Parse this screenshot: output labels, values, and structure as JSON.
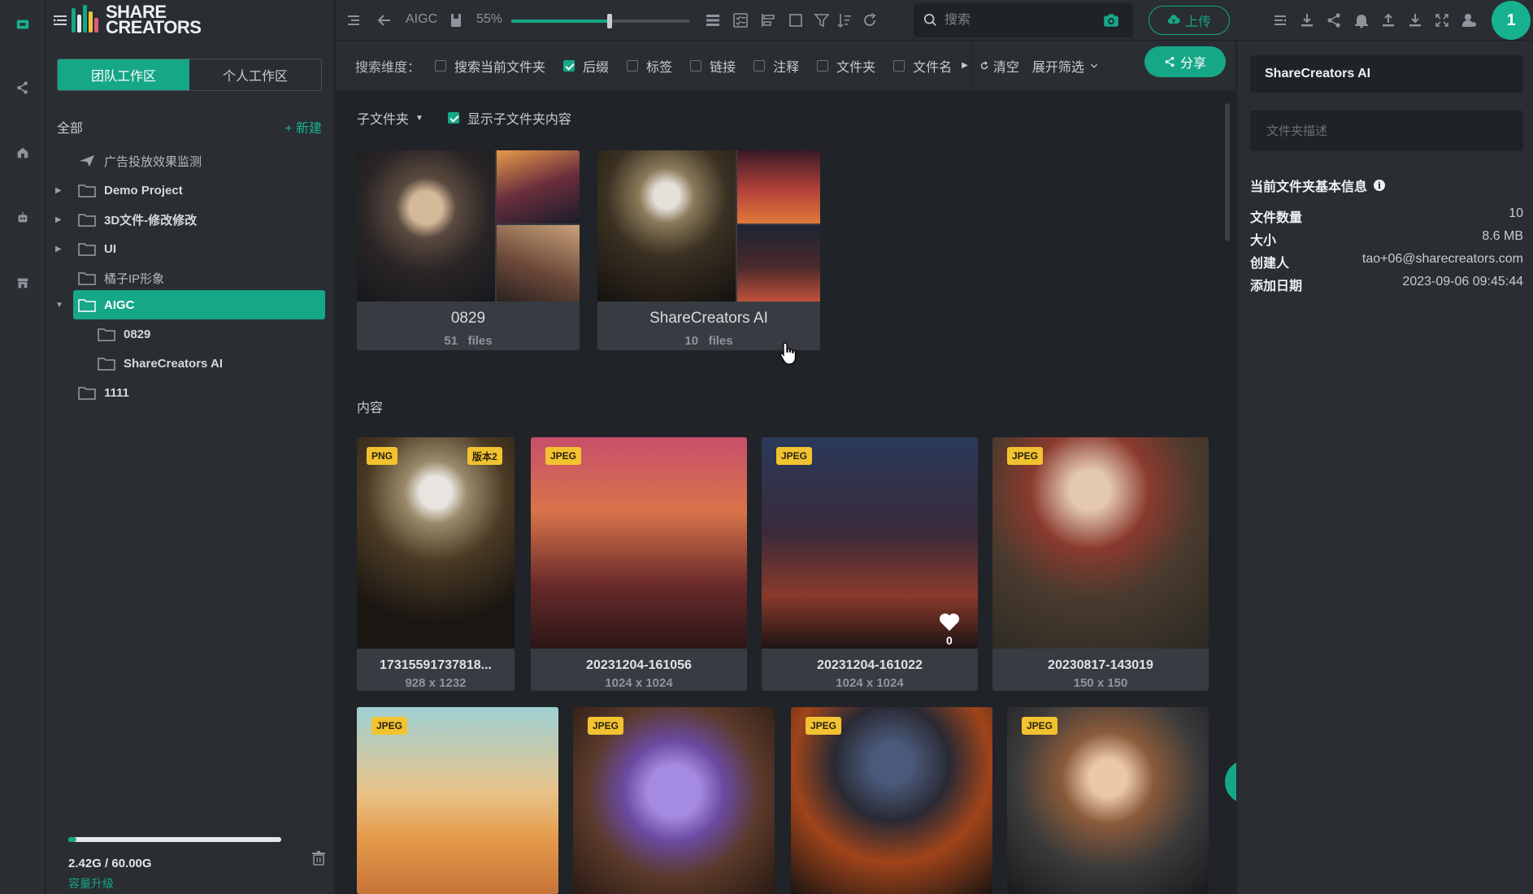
{
  "app": {
    "logo_text_line1": "SHARE",
    "logo_text_line2": "CREATORS",
    "accent_color": "#16a787"
  },
  "rail": {
    "icons": [
      "library-icon",
      "share-icon",
      "home-icon",
      "robot-icon",
      "store-icon"
    ]
  },
  "sidebar": {
    "tabs": [
      {
        "label": "团队工作区",
        "active": true
      },
      {
        "label": "个人工作区",
        "active": false
      }
    ],
    "tree_header": {
      "all_label": "全部",
      "new_label": "+ 新建"
    },
    "items": [
      {
        "label": "广告投放效果监测",
        "icon": "send-icon",
        "expandable": false
      },
      {
        "label": "Demo Project",
        "icon": "folder-icon",
        "expandable": true
      },
      {
        "label": "3D文件-修改修改",
        "icon": "folder-icon",
        "expandable": true
      },
      {
        "label": "UI",
        "icon": "folder-icon",
        "expandable": true
      },
      {
        "label": "橘子IP形象",
        "icon": "folder-icon",
        "expandable": false
      },
      {
        "label": "AIGC",
        "icon": "folder-icon",
        "expandable": true,
        "selected": true
      },
      {
        "label": "0829",
        "icon": "folder-icon",
        "child": true
      },
      {
        "label": "ShareCreators AI",
        "icon": "folder-icon",
        "child": true
      },
      {
        "label": "1111",
        "icon": "folder-icon",
        "expandable": false
      }
    ],
    "storage": {
      "used_text": "2.42G / 60.00G",
      "used_fraction": 0.04,
      "upgrade_label": "容量升级"
    }
  },
  "toolbar": {
    "current_folder": "AIGC",
    "zoom_label": "55%",
    "zoom_fraction": 0.55,
    "search_placeholder": "搜索",
    "upload_label": "上传",
    "avatar_initial": "1"
  },
  "filter": {
    "dimension_label": "搜索维度：",
    "options": [
      {
        "label": "搜索当前文件夹",
        "checked": false
      },
      {
        "label": "后缀",
        "checked": true
      },
      {
        "label": "标签",
        "checked": false
      },
      {
        "label": "链接",
        "checked": false
      },
      {
        "label": "注释",
        "checked": false
      },
      {
        "label": "文件夹",
        "checked": false
      },
      {
        "label": "文件名",
        "checked": false
      }
    ],
    "clear_label": "清空",
    "expand_label": "展开筛选",
    "share_label": "分享"
  },
  "main": {
    "subfolder_dropdown": "子文件夹",
    "show_sub_label": "显示子文件夹内容",
    "show_sub_checked": true,
    "folders": [
      {
        "name": "0829",
        "count": "51",
        "count_unit": "files"
      },
      {
        "name": "ShareCreators AI",
        "count": "10",
        "count_unit": "files"
      }
    ],
    "content_title": "内容",
    "cards": [
      {
        "name": "17315591737818...",
        "dims": "928 x 1232",
        "badges": [
          "PNG",
          "版本2"
        ]
      },
      {
        "name": "20231204-161056",
        "dims": "1024 x 1024",
        "badges": [
          "JPEG"
        ]
      },
      {
        "name": "20231204-161022",
        "dims": "1024 x 1024",
        "badges": [
          "JPEG"
        ],
        "likes": "0"
      },
      {
        "name": "20230817-143019",
        "dims": "150 x 150",
        "badges": [
          "JPEG"
        ]
      },
      {
        "name": "",
        "dims": "",
        "badges": [
          "JPEG"
        ]
      },
      {
        "name": "",
        "dims": "",
        "badges": [
          "JPEG"
        ]
      },
      {
        "name": "",
        "dims": "",
        "badges": [
          "JPEG"
        ]
      },
      {
        "name": "",
        "dims": "",
        "badges": [
          "JPEG"
        ]
      }
    ]
  },
  "details": {
    "title": "ShareCreators AI",
    "desc_placeholder": "文件夹描述",
    "section_title": "当前文件夹基本信息",
    "rows": [
      {
        "key": "文件数量",
        "value": "10"
      },
      {
        "key": "大小",
        "value": "8.6 MB"
      },
      {
        "key": "创建人",
        "value": "tao+06@sharecreators.com"
      },
      {
        "key": "添加日期",
        "value": "2023-09-06 09:45:44"
      }
    ]
  }
}
